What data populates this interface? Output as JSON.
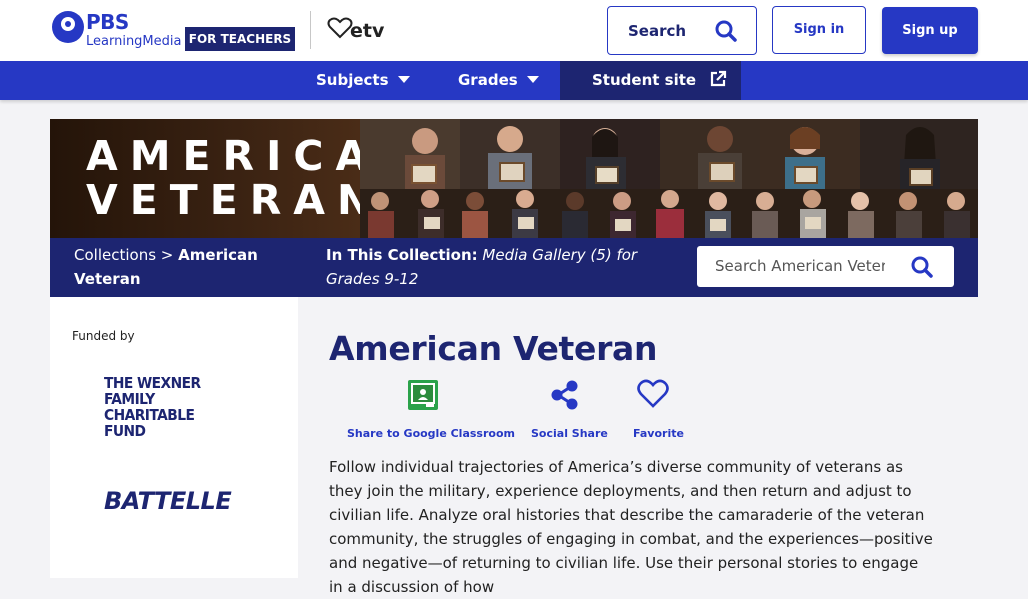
{
  "header": {
    "logo_pbs": "PBS",
    "logo_lm": "LearningMedia",
    "for_teachers": "FOR TEACHERS",
    "partner_logo": "etv",
    "search_label": "Search",
    "signin_label": "Sign in",
    "signup_label": "Sign up"
  },
  "nav": {
    "items": [
      {
        "label": "Subjects"
      },
      {
        "label": "Grades"
      },
      {
        "label": "Student site"
      }
    ]
  },
  "banner": {
    "title_line1": "AMERICAN",
    "title_line2": "VETERAN"
  },
  "collection_bar": {
    "crumb_root": "Collections",
    "crumb_sep": ">",
    "crumb_current": "American Veteran",
    "in_collection_label": "In This Collection:",
    "in_collection_value": "Media Gallery (5) for Grades 9-12",
    "search_placeholder": "Search American Veteran"
  },
  "sidebar": {
    "funded_by": "Funded by",
    "funder1": "THE WEXNER FAMILY CHARITABLE FUND",
    "funder2": "BATTELLE"
  },
  "main": {
    "title": "American Veteran",
    "actions": [
      {
        "label": "Share to Google Classroom",
        "icon": "google-classroom-icon"
      },
      {
        "label": "Social Share",
        "icon": "share-icon"
      },
      {
        "label": "Favorite",
        "icon": "heart-icon"
      }
    ],
    "description": "Follow individual trajectories of America’s diverse community of veterans as they join the military, experience deployments, and then return and adjust to civilian life. Analyze oral histories that describe the camaraderie of the veteran community, the struggles of engaging in combat, and the experiences—positive and negative—of returning to civilian life. Use their personal stories to engage in a discussion of how"
  },
  "colors": {
    "brand_blue": "#2638c4",
    "navy": "#1d2571",
    "background": "#f3f3f6"
  }
}
